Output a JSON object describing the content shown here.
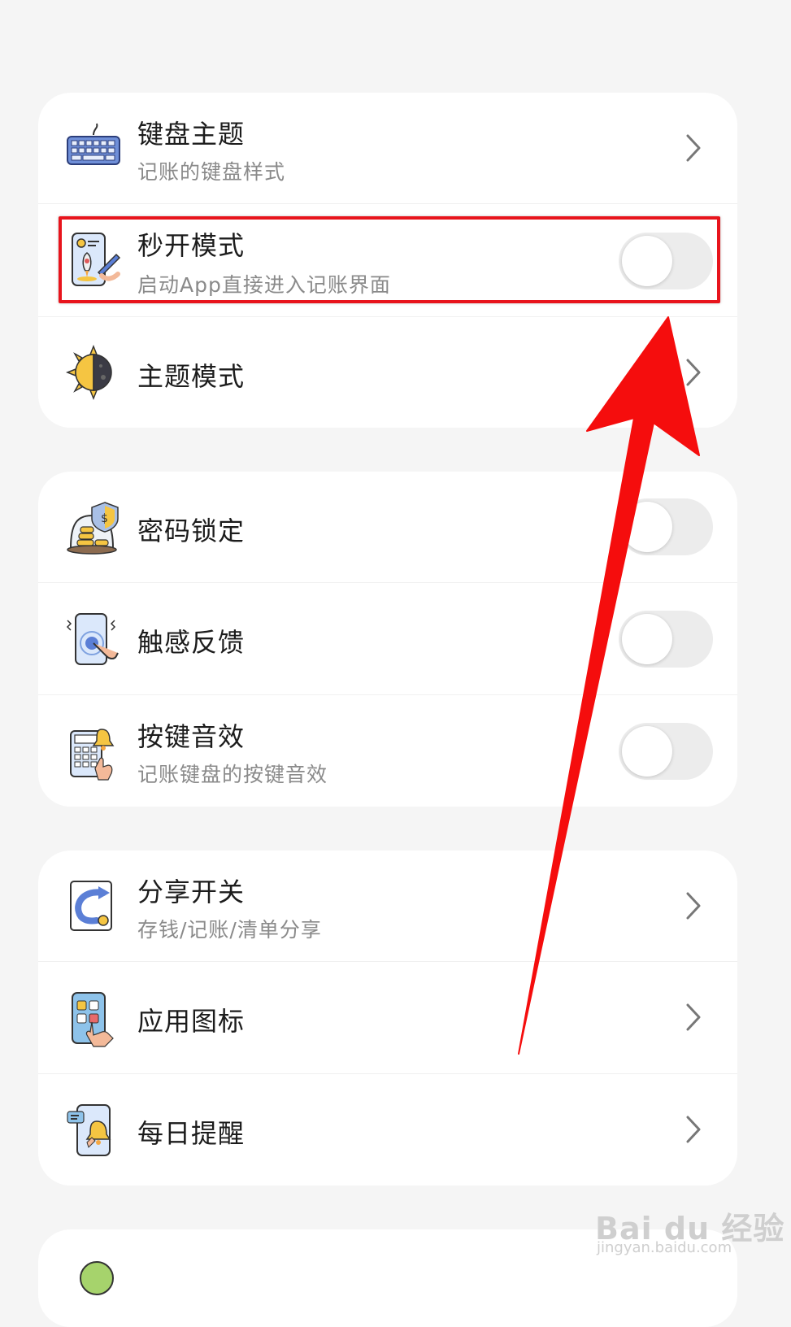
{
  "settings": {
    "group1": [
      {
        "title": "键盘主题",
        "subtitle": "记账的键盘样式",
        "icon": "keyboard-icon",
        "control": "chevron"
      },
      {
        "title": "秒开模式",
        "subtitle": "启动App直接进入记账界面",
        "icon": "rocket-phone-icon",
        "control": "toggle",
        "on": false
      },
      {
        "title": "主题模式",
        "icon": "sun-moon-icon",
        "control": "chevron"
      }
    ],
    "group2": [
      {
        "title": "密码锁定",
        "icon": "coin-shield-icon",
        "control": "toggle",
        "on": false
      },
      {
        "title": "触感反馈",
        "icon": "phone-touch-icon",
        "control": "toggle",
        "on": false
      },
      {
        "title": "按键音效",
        "subtitle": "记账键盘的按键音效",
        "icon": "calculator-bell-icon",
        "control": "toggle",
        "on": false
      }
    ],
    "group3": [
      {
        "title": "分享开关",
        "subtitle": "存钱/记账/清单分享",
        "icon": "share-icon",
        "control": "chevron"
      },
      {
        "title": "应用图标",
        "icon": "app-icon-hand-icon",
        "control": "chevron"
      },
      {
        "title": "每日提醒",
        "icon": "phone-bell-icon",
        "control": "chevron"
      }
    ]
  },
  "watermark": {
    "logo": "Bai du 经验",
    "url": "jingyan.baidu.com"
  },
  "colors": {
    "highlight": "#e8141c",
    "arrow": "#f50d0d",
    "toggle_off": "#ececec"
  }
}
